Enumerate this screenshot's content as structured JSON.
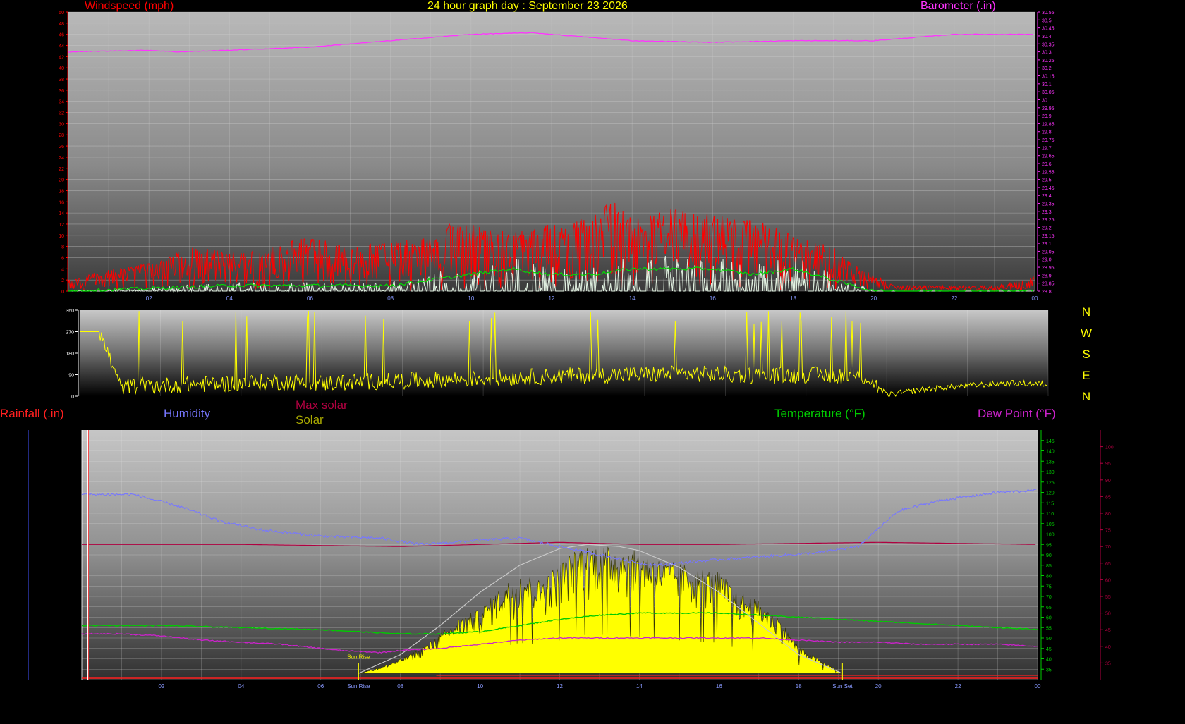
{
  "colors": {
    "background": "#000000",
    "wind": "#ff0000",
    "gust": "#ff0000",
    "wind_avg": "#00dd00",
    "wind_low": "#e0f0e0",
    "barometer": "#ff33ff",
    "direction": "#ffff00",
    "rainfall": "#ff2020",
    "humidity": "#7777ff",
    "max_solar": "#b00040",
    "solar": "#ffff00",
    "solar_label": "#aaaa00",
    "temperature": "#00cc00",
    "dew_point": "#cc22cc",
    "title": "#ffff00",
    "sun_curve": "#c8c8c8"
  },
  "title": "24 hour graph day : September 23 2026",
  "top_panel": {
    "left_label": "Windspeed (mph)",
    "right_label": "Barometer (.in)"
  },
  "direction_panel": {
    "compass_labels": [
      "N",
      "W",
      "S",
      "E",
      "N"
    ]
  },
  "bottom_panel": {
    "labels": {
      "rainfall": "Rainfall (.in)",
      "humidity": "Humidity",
      "max_solar": "Max solar",
      "solar": "Solar",
      "temperature": "Temperature (°F)",
      "dew_point": "Dew Point (°F)"
    },
    "sun_rise_label": "Sun Rise",
    "sun_set_label": "Sun Set"
  },
  "chart_data": [
    {
      "type": "line",
      "title": "24 hour graph day : September 23 2026",
      "xlabel": "",
      "x_ticks": [
        "02",
        "04",
        "06",
        "08",
        "10",
        "12",
        "14",
        "16",
        "18",
        "20",
        "22",
        "00"
      ],
      "xlim": [
        0,
        24
      ],
      "ylabel": "Windspeed (mph)",
      "ylim": [
        0,
        50
      ],
      "y_ticks": [
        0,
        2,
        4,
        6,
        8,
        10,
        12,
        14,
        16,
        18,
        20,
        22,
        24,
        26,
        28,
        30,
        32,
        34,
        36,
        38,
        40,
        42,
        44,
        46,
        48,
        50
      ],
      "y2label": "Barometer (.in)",
      "y2lim": [
        28.8,
        30.55
      ],
      "y2_ticks": [
        28.8,
        28.85,
        28.9,
        28.95,
        29.0,
        29.05,
        29.1,
        29.15,
        29.2,
        29.25,
        29.3,
        29.35,
        29.4,
        29.45,
        29.5,
        29.55,
        29.6,
        29.65,
        29.7,
        29.75,
        29.8,
        29.85,
        29.9,
        29.95,
        30.0,
        30.05,
        30.1,
        30.15,
        30.2,
        30.25,
        30.3,
        30.35,
        30.4,
        30.45,
        30.5,
        30.55
      ],
      "grid": true,
      "series": [
        {
          "name": "Barometer (.in)",
          "axis": "right",
          "x": [
            0,
            2,
            2.7,
            4,
            6,
            8,
            10,
            11.5,
            12.5,
            14,
            16,
            18,
            20,
            22,
            24
          ],
          "values": [
            30.3,
            30.31,
            30.3,
            30.31,
            30.33,
            30.37,
            30.41,
            30.42,
            30.4,
            30.37,
            30.36,
            30.37,
            30.37,
            30.41,
            30.41
          ]
        },
        {
          "name": "Gust (envelope, mph)",
          "x": [
            0,
            0.5,
            1,
            2,
            3,
            4,
            5,
            6,
            7,
            8,
            9,
            9.5,
            10,
            11,
            12,
            13,
            13.5,
            14,
            15,
            16,
            17,
            18,
            19,
            19.5,
            20,
            20.5,
            21,
            22,
            23,
            24
          ],
          "values": [
            2,
            3,
            4,
            5,
            8,
            7,
            8,
            10,
            8,
            9,
            10,
            13,
            12,
            11,
            12,
            13,
            17,
            13,
            15,
            14,
            13,
            10,
            8,
            5,
            3,
            1,
            1,
            1,
            1,
            3
          ]
        },
        {
          "name": "Average wind (mph)",
          "x": [
            0,
            2,
            4,
            6,
            8,
            9,
            10,
            11,
            12,
            13,
            14,
            15,
            16,
            17,
            18,
            19,
            19.5,
            20,
            24
          ],
          "values": [
            0,
            0.5,
            1,
            1,
            1,
            2,
            3,
            4,
            3,
            3,
            4,
            4,
            4,
            3,
            4,
            2,
            1,
            0,
            0
          ]
        }
      ]
    },
    {
      "type": "line",
      "ylabel": "",
      "ylim": [
        0,
        360
      ],
      "y_ticks": [
        0,
        90,
        180,
        270,
        360
      ],
      "xlim": [
        0,
        24
      ],
      "grid": false,
      "series": [
        {
          "name": "Wind direction",
          "x": [
            0,
            0.5,
            1,
            2,
            3,
            4,
            5,
            6,
            7,
            8,
            9,
            10,
            11,
            12,
            13,
            14,
            15,
            16,
            17,
            18,
            19,
            19.5,
            20,
            21,
            22,
            23,
            24
          ],
          "values": [
            270,
            270,
            40,
            45,
            50,
            55,
            60,
            55,
            60,
            65,
            70,
            75,
            80,
            85,
            90,
            90,
            95,
            90,
            85,
            90,
            85,
            80,
            5,
            30,
            45,
            55,
            50
          ]
        }
      ]
    },
    {
      "type": "area",
      "xlim": [
        0,
        24
      ],
      "x_ticks": [
        "02",
        "04",
        "06",
        "Sun Rise",
        "08",
        "10",
        "12",
        "14",
        "16",
        "18",
        "Sun Set",
        "20",
        "22",
        "00"
      ],
      "y_temperature_lim": [
        30,
        150
      ],
      "y_temperature_ticks": [
        35,
        40,
        45,
        50,
        55,
        60,
        65,
        70,
        75,
        80,
        85,
        90,
        95,
        100,
        105,
        110,
        115,
        120,
        125,
        130,
        135,
        140,
        145
      ],
      "y_dewpoint_lim": [
        30,
        105
      ],
      "y_dewpoint_ticks": [
        35,
        40,
        45,
        50,
        55,
        60,
        65,
        70,
        75,
        80,
        85,
        90,
        95,
        100
      ],
      "grid": true,
      "sun_rise_hour": 6.95,
      "sun_set_hour": 19.1,
      "series": [
        {
          "name": "Humidity",
          "x": [
            0,
            1.3,
            2.5,
            3.5,
            4.5,
            6,
            7.5,
            8.5,
            10,
            11,
            12,
            13,
            14,
            14.5,
            15.5,
            17,
            18.5,
            19.5,
            20.5,
            21.5,
            23,
            24
          ],
          "values": [
            119,
            119,
            113,
            106,
            102,
            99,
            98,
            95,
            97,
            98,
            94,
            90,
            86,
            85,
            87,
            89,
            91,
            94,
            111,
            116,
            120,
            121
          ]
        },
        {
          "name": "Max solar (flat line)",
          "x": [
            0,
            4,
            8,
            12,
            14,
            16,
            20,
            24
          ],
          "values": [
            95,
            95,
            94,
            96,
            95,
            95,
            96,
            95
          ]
        },
        {
          "name": "Temperature (°F)",
          "x": [
            0,
            2,
            4,
            6,
            7,
            8,
            9,
            10,
            11,
            12,
            13,
            14,
            15,
            16,
            17,
            18,
            19,
            20,
            21,
            22,
            23,
            24
          ],
          "values": [
            56,
            56,
            55,
            54,
            53,
            52,
            52,
            53,
            56,
            59,
            61,
            62,
            62,
            62,
            61,
            60,
            59,
            58,
            57,
            56,
            55,
            54
          ]
        },
        {
          "name": "Dew Point (°F)",
          "x": [
            0,
            1,
            2,
            3,
            4,
            5,
            6,
            6.5,
            7.5,
            8,
            9,
            10,
            11,
            12,
            13,
            14,
            15,
            16,
            17,
            18,
            19,
            20,
            21,
            22,
            23,
            24
          ],
          "values": [
            52,
            52,
            51,
            49,
            48,
            47,
            45,
            44,
            43,
            44,
            45,
            47,
            49,
            50,
            50,
            50,
            50,
            50,
            50,
            49,
            48,
            48,
            47,
            47,
            47,
            46
          ]
        },
        {
          "name": "Solar (envelope)",
          "x": [
            6.95,
            7.5,
            8,
            8.5,
            9,
            9.5,
            10,
            10.5,
            11,
            11.5,
            12,
            12.5,
            13,
            13.5,
            14,
            14.5,
            15,
            15.5,
            16,
            16.5,
            17,
            17.5,
            18,
            18.5,
            19.1
          ],
          "values": [
            33,
            36,
            40,
            45,
            52,
            60,
            64,
            74,
            82,
            78,
            86,
            94,
            95,
            93,
            92,
            88,
            86,
            84,
            82,
            72,
            68,
            60,
            46,
            40,
            33
          ]
        },
        {
          "name": "Max solar curve",
          "x": [
            6.95,
            8,
            9,
            10,
            11,
            12,
            12.7,
            13.5,
            14,
            15,
            16,
            17,
            18,
            19.1
          ],
          "values": [
            33,
            42,
            56,
            72,
            85,
            93,
            95,
            94,
            92,
            84,
            72,
            57,
            42,
            33
          ]
        },
        {
          "name": "Rainfall (.in)",
          "x": [
            0,
            24
          ],
          "values": [
            0,
            0
          ]
        }
      ]
    }
  ]
}
